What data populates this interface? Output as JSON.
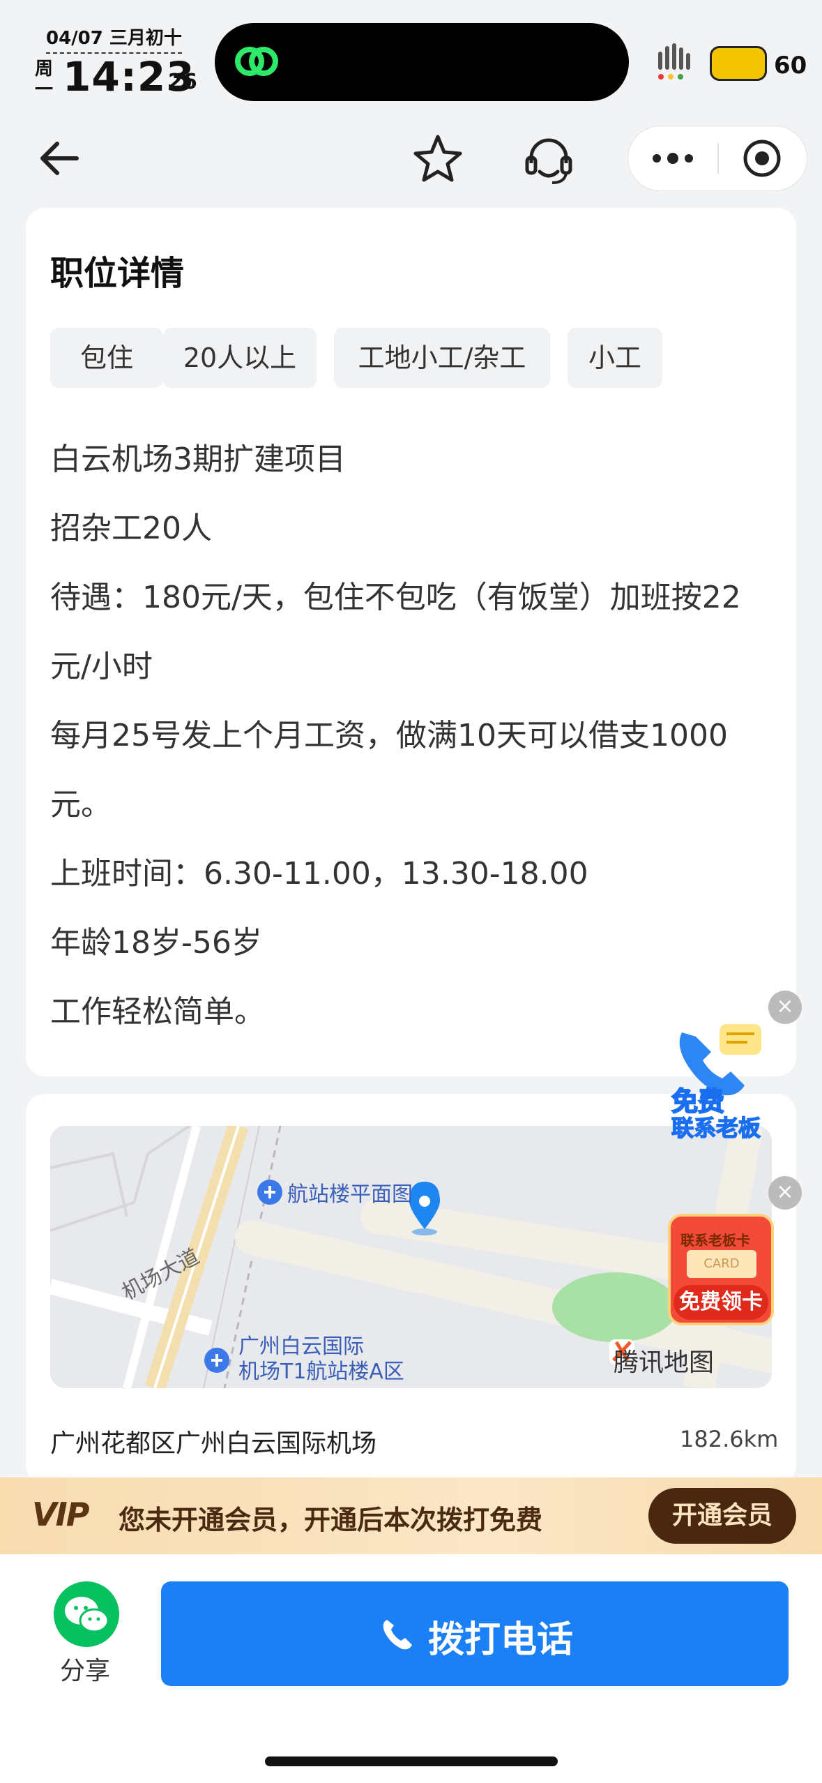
{
  "status_bar": {
    "date": "04/07 三月初十",
    "weekday": "周一",
    "time": "14:23",
    "seconds": "26",
    "battery": "60"
  },
  "detail": {
    "title": "职位详情",
    "tags": [
      "包住",
      "20人以上",
      "工地小工/杂工",
      "小工"
    ],
    "lines": [
      "白云机场3期扩建项目",
      "招杂工20人",
      "待遇：180元/天，包住不包吃（有饭堂）加班按22",
      "元/小时",
      "每月25号发上个月工资，做满10天可以借支1000",
      "元。",
      "上班时间：6.30-11.00，13.30-18.00",
      "年龄18岁-56岁",
      "工作轻松简单。"
    ]
  },
  "map": {
    "labels": [
      "航站楼平面图",
      "机场大道",
      "广州白云国际",
      "机场T1航站楼A区"
    ],
    "brand": "腾讯地图",
    "address": "广州花都区广州白云国际机场",
    "distance": "182.6km"
  },
  "floating": {
    "ad1_line1": "免费",
    "ad1_line2": "联系老板",
    "ad2_top": "联系老板卡",
    "ad2_card": "CARD",
    "ad2_button": "免费领卡",
    "close": "×"
  },
  "vip": {
    "logo": "VIP",
    "text": "您未开通会员，开通后本次拨打免费",
    "button": "开通会员"
  },
  "bottom": {
    "share": "分享",
    "call": "拨打电话"
  }
}
